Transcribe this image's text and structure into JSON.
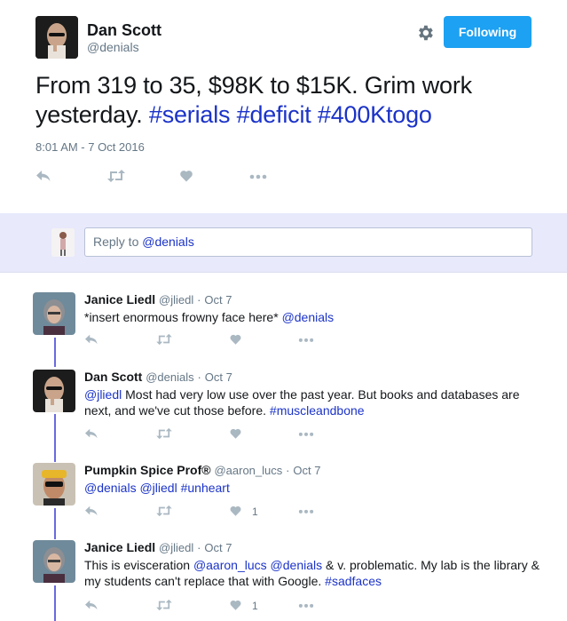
{
  "tweet": {
    "author_name": "Dan Scott",
    "author_handle": "@denials",
    "follow_label": "Following",
    "text_plain": "From 319 to 35, $98K to $15K. Grim work yesterday.",
    "hashtags": [
      "#serials",
      "#deficit",
      "#400Ktogo"
    ],
    "timestamp": "8:01 AM - 7 Oct 2016"
  },
  "reply_box": {
    "placeholder_prefix": "Reply to",
    "placeholder_mention": "@denials"
  },
  "replies": [
    {
      "name": "Janice Liedl",
      "handle": "@jliedl",
      "time": "Oct 7",
      "text_parts": [
        {
          "t": "*insert enormous frowny face here* ",
          "link": false
        },
        {
          "t": "@denials",
          "link": true
        }
      ],
      "like_count": ""
    },
    {
      "name": "Dan Scott",
      "handle": "@denials",
      "time": "Oct 7",
      "text_parts": [
        {
          "t": "@jliedl",
          "link": true
        },
        {
          "t": " Most had very low use over the past year. But books and databases are next, and we've cut those before. ",
          "link": false
        },
        {
          "t": "#muscleandbone",
          "link": true
        }
      ],
      "like_count": ""
    },
    {
      "name": "Pumpkin Spice Prof®",
      "handle": "@aaron_lucs",
      "time": "Oct 7",
      "text_parts": [
        {
          "t": "@denials",
          "link": true
        },
        {
          "t": " ",
          "link": false
        },
        {
          "t": "@jliedl",
          "link": true
        },
        {
          "t": " ",
          "link": false
        },
        {
          "t": "#unheart",
          "link": true
        }
      ],
      "like_count": "1"
    },
    {
      "name": "Janice Liedl",
      "handle": "@jliedl",
      "time": "Oct 7",
      "text_parts": [
        {
          "t": "This is evisceration ",
          "link": false
        },
        {
          "t": "@aaron_lucs",
          "link": true
        },
        {
          "t": " ",
          "link": false
        },
        {
          "t": "@denials",
          "link": true
        },
        {
          "t": " & v. problematic. My lab is the library & my students can't replace that with Google. ",
          "link": false
        },
        {
          "t": "#sadfaces",
          "link": true
        }
      ],
      "like_count": "1"
    }
  ],
  "colors": {
    "accent": "#1da1f2",
    "link": "#1b33c8",
    "thread_line": "#6a6ae0",
    "reply_bar_bg": "#e8e9fb"
  }
}
